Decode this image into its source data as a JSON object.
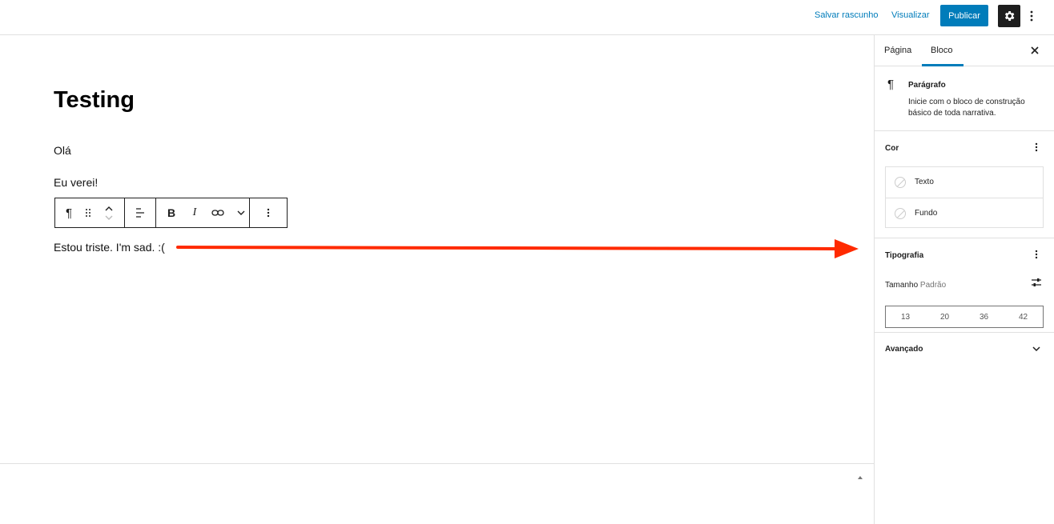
{
  "topbar": {
    "save_draft": "Salvar rascunho",
    "preview": "Visualizar",
    "publish": "Publicar",
    "settings_icon": "gear-icon",
    "more_icon": "kebab-vertical-icon",
    "accent_color": "#007cba"
  },
  "editor": {
    "title": "Testing",
    "paragraphs": [
      "Olá",
      "Eu verei!",
      "Estou triste. I'm sad. :("
    ],
    "toolbar": {
      "paragraph_icon": "¶",
      "buttons": [
        "paragraph-icon",
        "drag-handle-icon",
        "move-up-icon",
        "move-down-icon",
        "align-left-icon",
        "bold-icon",
        "italic-icon",
        "link-icon",
        "chevron-down-icon",
        "more-options-icon"
      ],
      "bold": "B",
      "italic": "I"
    },
    "annotation_color": "#ff2a00"
  },
  "sidebar": {
    "tabs": [
      "Página",
      "Bloco"
    ],
    "active_tab": "Bloco",
    "block": {
      "icon": "¶",
      "name": "Parágrafo",
      "description": "Inicie com o bloco de construção básico de toda narrativa."
    },
    "color_panel": {
      "title": "Cor",
      "items": [
        "Texto",
        "Fundo"
      ]
    },
    "typography_panel": {
      "title": "Tipografia",
      "size_label": "Tamanho",
      "size_value": "Padrão",
      "sizes": [
        "13",
        "20",
        "36",
        "42"
      ]
    },
    "advanced_panel": {
      "title": "Avançado"
    }
  }
}
